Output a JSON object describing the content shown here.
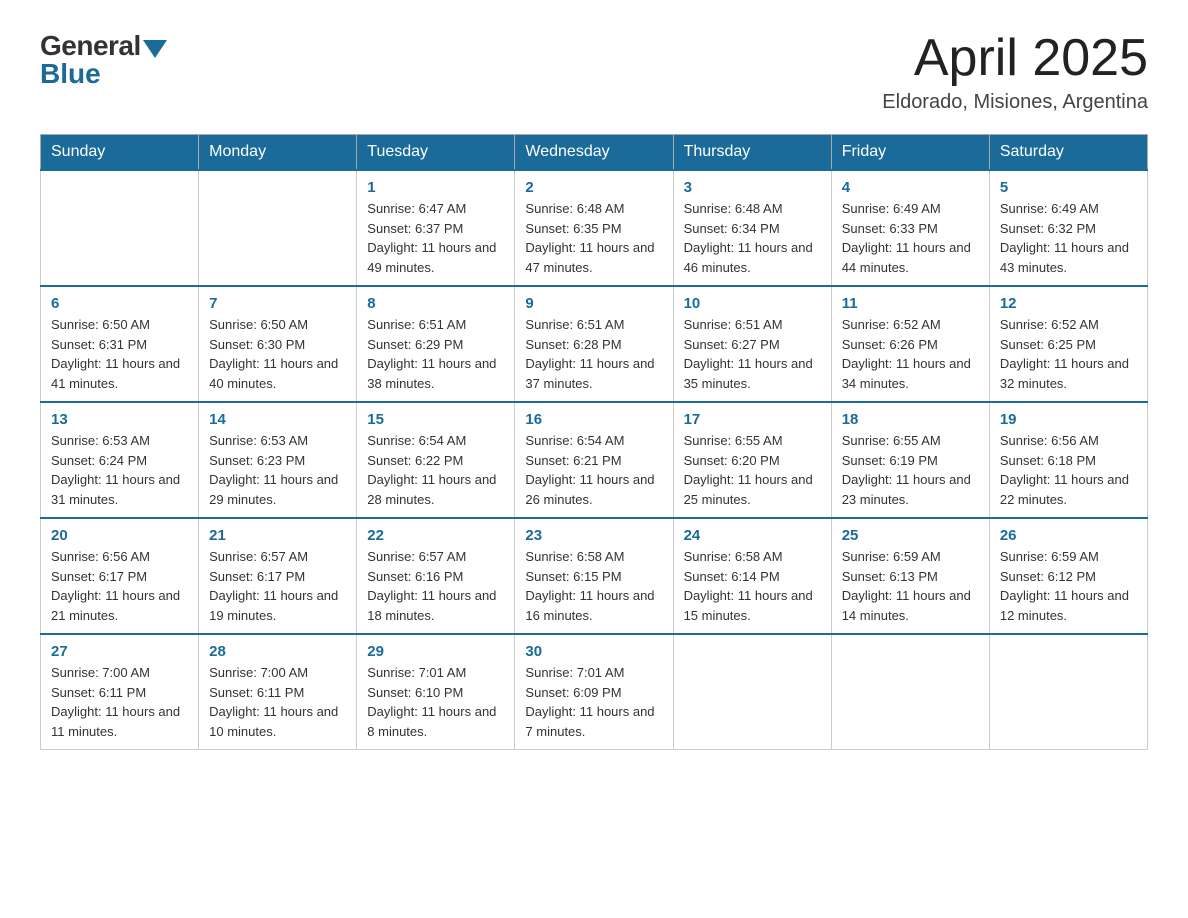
{
  "header": {
    "logo_general": "General",
    "logo_blue": "Blue",
    "month_title": "April 2025",
    "location": "Eldorado, Misiones, Argentina"
  },
  "days_of_week": [
    "Sunday",
    "Monday",
    "Tuesday",
    "Wednesday",
    "Thursday",
    "Friday",
    "Saturday"
  ],
  "weeks": [
    [
      {
        "day": "",
        "sunrise": "",
        "sunset": "",
        "daylight": ""
      },
      {
        "day": "",
        "sunrise": "",
        "sunset": "",
        "daylight": ""
      },
      {
        "day": "1",
        "sunrise": "Sunrise: 6:47 AM",
        "sunset": "Sunset: 6:37 PM",
        "daylight": "Daylight: 11 hours and 49 minutes."
      },
      {
        "day": "2",
        "sunrise": "Sunrise: 6:48 AM",
        "sunset": "Sunset: 6:35 PM",
        "daylight": "Daylight: 11 hours and 47 minutes."
      },
      {
        "day": "3",
        "sunrise": "Sunrise: 6:48 AM",
        "sunset": "Sunset: 6:34 PM",
        "daylight": "Daylight: 11 hours and 46 minutes."
      },
      {
        "day": "4",
        "sunrise": "Sunrise: 6:49 AM",
        "sunset": "Sunset: 6:33 PM",
        "daylight": "Daylight: 11 hours and 44 minutes."
      },
      {
        "day": "5",
        "sunrise": "Sunrise: 6:49 AM",
        "sunset": "Sunset: 6:32 PM",
        "daylight": "Daylight: 11 hours and 43 minutes."
      }
    ],
    [
      {
        "day": "6",
        "sunrise": "Sunrise: 6:50 AM",
        "sunset": "Sunset: 6:31 PM",
        "daylight": "Daylight: 11 hours and 41 minutes."
      },
      {
        "day": "7",
        "sunrise": "Sunrise: 6:50 AM",
        "sunset": "Sunset: 6:30 PM",
        "daylight": "Daylight: 11 hours and 40 minutes."
      },
      {
        "day": "8",
        "sunrise": "Sunrise: 6:51 AM",
        "sunset": "Sunset: 6:29 PM",
        "daylight": "Daylight: 11 hours and 38 minutes."
      },
      {
        "day": "9",
        "sunrise": "Sunrise: 6:51 AM",
        "sunset": "Sunset: 6:28 PM",
        "daylight": "Daylight: 11 hours and 37 minutes."
      },
      {
        "day": "10",
        "sunrise": "Sunrise: 6:51 AM",
        "sunset": "Sunset: 6:27 PM",
        "daylight": "Daylight: 11 hours and 35 minutes."
      },
      {
        "day": "11",
        "sunrise": "Sunrise: 6:52 AM",
        "sunset": "Sunset: 6:26 PM",
        "daylight": "Daylight: 11 hours and 34 minutes."
      },
      {
        "day": "12",
        "sunrise": "Sunrise: 6:52 AM",
        "sunset": "Sunset: 6:25 PM",
        "daylight": "Daylight: 11 hours and 32 minutes."
      }
    ],
    [
      {
        "day": "13",
        "sunrise": "Sunrise: 6:53 AM",
        "sunset": "Sunset: 6:24 PM",
        "daylight": "Daylight: 11 hours and 31 minutes."
      },
      {
        "day": "14",
        "sunrise": "Sunrise: 6:53 AM",
        "sunset": "Sunset: 6:23 PM",
        "daylight": "Daylight: 11 hours and 29 minutes."
      },
      {
        "day": "15",
        "sunrise": "Sunrise: 6:54 AM",
        "sunset": "Sunset: 6:22 PM",
        "daylight": "Daylight: 11 hours and 28 minutes."
      },
      {
        "day": "16",
        "sunrise": "Sunrise: 6:54 AM",
        "sunset": "Sunset: 6:21 PM",
        "daylight": "Daylight: 11 hours and 26 minutes."
      },
      {
        "day": "17",
        "sunrise": "Sunrise: 6:55 AM",
        "sunset": "Sunset: 6:20 PM",
        "daylight": "Daylight: 11 hours and 25 minutes."
      },
      {
        "day": "18",
        "sunrise": "Sunrise: 6:55 AM",
        "sunset": "Sunset: 6:19 PM",
        "daylight": "Daylight: 11 hours and 23 minutes."
      },
      {
        "day": "19",
        "sunrise": "Sunrise: 6:56 AM",
        "sunset": "Sunset: 6:18 PM",
        "daylight": "Daylight: 11 hours and 22 minutes."
      }
    ],
    [
      {
        "day": "20",
        "sunrise": "Sunrise: 6:56 AM",
        "sunset": "Sunset: 6:17 PM",
        "daylight": "Daylight: 11 hours and 21 minutes."
      },
      {
        "day": "21",
        "sunrise": "Sunrise: 6:57 AM",
        "sunset": "Sunset: 6:17 PM",
        "daylight": "Daylight: 11 hours and 19 minutes."
      },
      {
        "day": "22",
        "sunrise": "Sunrise: 6:57 AM",
        "sunset": "Sunset: 6:16 PM",
        "daylight": "Daylight: 11 hours and 18 minutes."
      },
      {
        "day": "23",
        "sunrise": "Sunrise: 6:58 AM",
        "sunset": "Sunset: 6:15 PM",
        "daylight": "Daylight: 11 hours and 16 minutes."
      },
      {
        "day": "24",
        "sunrise": "Sunrise: 6:58 AM",
        "sunset": "Sunset: 6:14 PM",
        "daylight": "Daylight: 11 hours and 15 minutes."
      },
      {
        "day": "25",
        "sunrise": "Sunrise: 6:59 AM",
        "sunset": "Sunset: 6:13 PM",
        "daylight": "Daylight: 11 hours and 14 minutes."
      },
      {
        "day": "26",
        "sunrise": "Sunrise: 6:59 AM",
        "sunset": "Sunset: 6:12 PM",
        "daylight": "Daylight: 11 hours and 12 minutes."
      }
    ],
    [
      {
        "day": "27",
        "sunrise": "Sunrise: 7:00 AM",
        "sunset": "Sunset: 6:11 PM",
        "daylight": "Daylight: 11 hours and 11 minutes."
      },
      {
        "day": "28",
        "sunrise": "Sunrise: 7:00 AM",
        "sunset": "Sunset: 6:11 PM",
        "daylight": "Daylight: 11 hours and 10 minutes."
      },
      {
        "day": "29",
        "sunrise": "Sunrise: 7:01 AM",
        "sunset": "Sunset: 6:10 PM",
        "daylight": "Daylight: 11 hours and 8 minutes."
      },
      {
        "day": "30",
        "sunrise": "Sunrise: 7:01 AM",
        "sunset": "Sunset: 6:09 PM",
        "daylight": "Daylight: 11 hours and 7 minutes."
      },
      {
        "day": "",
        "sunrise": "",
        "sunset": "",
        "daylight": ""
      },
      {
        "day": "",
        "sunrise": "",
        "sunset": "",
        "daylight": ""
      },
      {
        "day": "",
        "sunrise": "",
        "sunset": "",
        "daylight": ""
      }
    ]
  ]
}
